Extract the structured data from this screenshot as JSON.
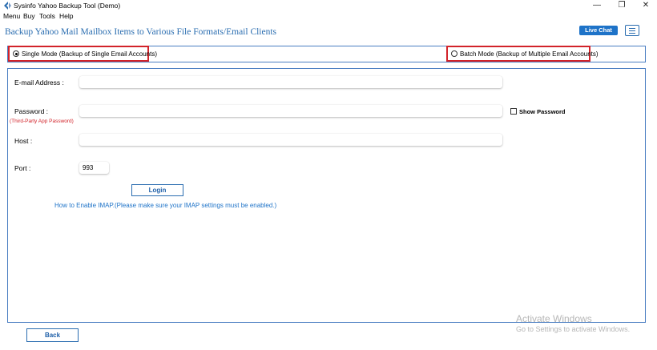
{
  "window": {
    "title": "Sysinfo Yahoo Backup Tool (Demo)",
    "minimize_glyph": "—",
    "restore_glyph": "❐",
    "close_glyph": "✕"
  },
  "menu": [
    "Menu",
    "Buy",
    "Tools",
    "Help"
  ],
  "header": {
    "title": "Backup Yahoo Mail Mailbox Items to Various File Formats/Email Clients",
    "live_chat_label": "Live Chat"
  },
  "modes": {
    "single": {
      "label": "Single Mode (Backup of Single Email Accounts)",
      "selected": true
    },
    "batch": {
      "label": "Batch Mode (Backup of Multiple Email Accounts)",
      "selected": false
    }
  },
  "form": {
    "email_label": "E-mail Address :",
    "email_value": "",
    "password_label": "Password :",
    "password_sublabel": "(Third-Party App Password)",
    "password_value": "",
    "show_password_label": "Show Password",
    "host_label": "Host :",
    "host_value": "",
    "port_label": "Port :",
    "port_value": "993",
    "login_label": "Login",
    "imap_link": "How to Enable IMAP.(Please make sure your IMAP settings must be enabled.)"
  },
  "footer": {
    "back_label": "Back"
  },
  "watermark": {
    "line1": "Activate Windows",
    "line2": "Go to Settings to activate Windows."
  },
  "colors": {
    "accent": "#2a6db0",
    "live_chat_bg": "#1e73c8",
    "highlight_border": "#d2232a",
    "panel_border": "#4a7ec2"
  }
}
